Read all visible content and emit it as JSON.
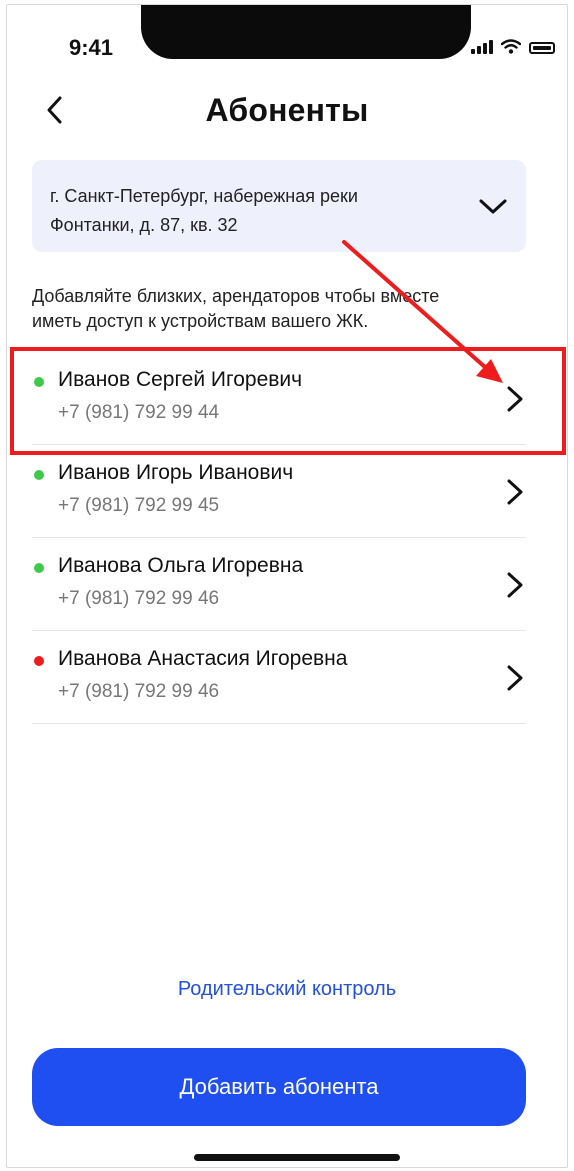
{
  "status_bar": {
    "time": "9:41"
  },
  "header": {
    "title": "Абоненты",
    "back_icon": "chevron-left-icon"
  },
  "address": {
    "line1": "г. Санкт-Петербург, набережная реки",
    "line2": "Фонтанки, д. 87, кв. 32",
    "toggle_icon": "chevron-down-icon"
  },
  "hint": {
    "line1": "Добавляйте близких, арендаторов чтобы вместе",
    "line2": "иметь доступ к устройствам вашего ЖК."
  },
  "subscribers": [
    {
      "name": "Иванов Сергей Игоревич",
      "phone": "+7 (981) 792 99 44",
      "status_color": "#3fc94a"
    },
    {
      "name": "Иванов Игорь Иванович",
      "phone": "+7 (981) 792 99 45",
      "status_color": "#3fc94a"
    },
    {
      "name": "Иванова Ольга Игоревна",
      "phone": "+7 (981) 792 99 46",
      "status_color": "#3fc94a"
    },
    {
      "name": "Иванова Анастасия Игоревна",
      "phone": "+7 (981) 792 99 46",
      "status_color": "#ee1c1c"
    }
  ],
  "footer": {
    "parental_control_link": "Родительский контроль",
    "add_button_label": "Добавить абонента"
  },
  "colors": {
    "accent": "#1f4ff0",
    "link": "#2450e0",
    "annotation": "#ee1c1c",
    "address_background": "#eef0fb"
  }
}
